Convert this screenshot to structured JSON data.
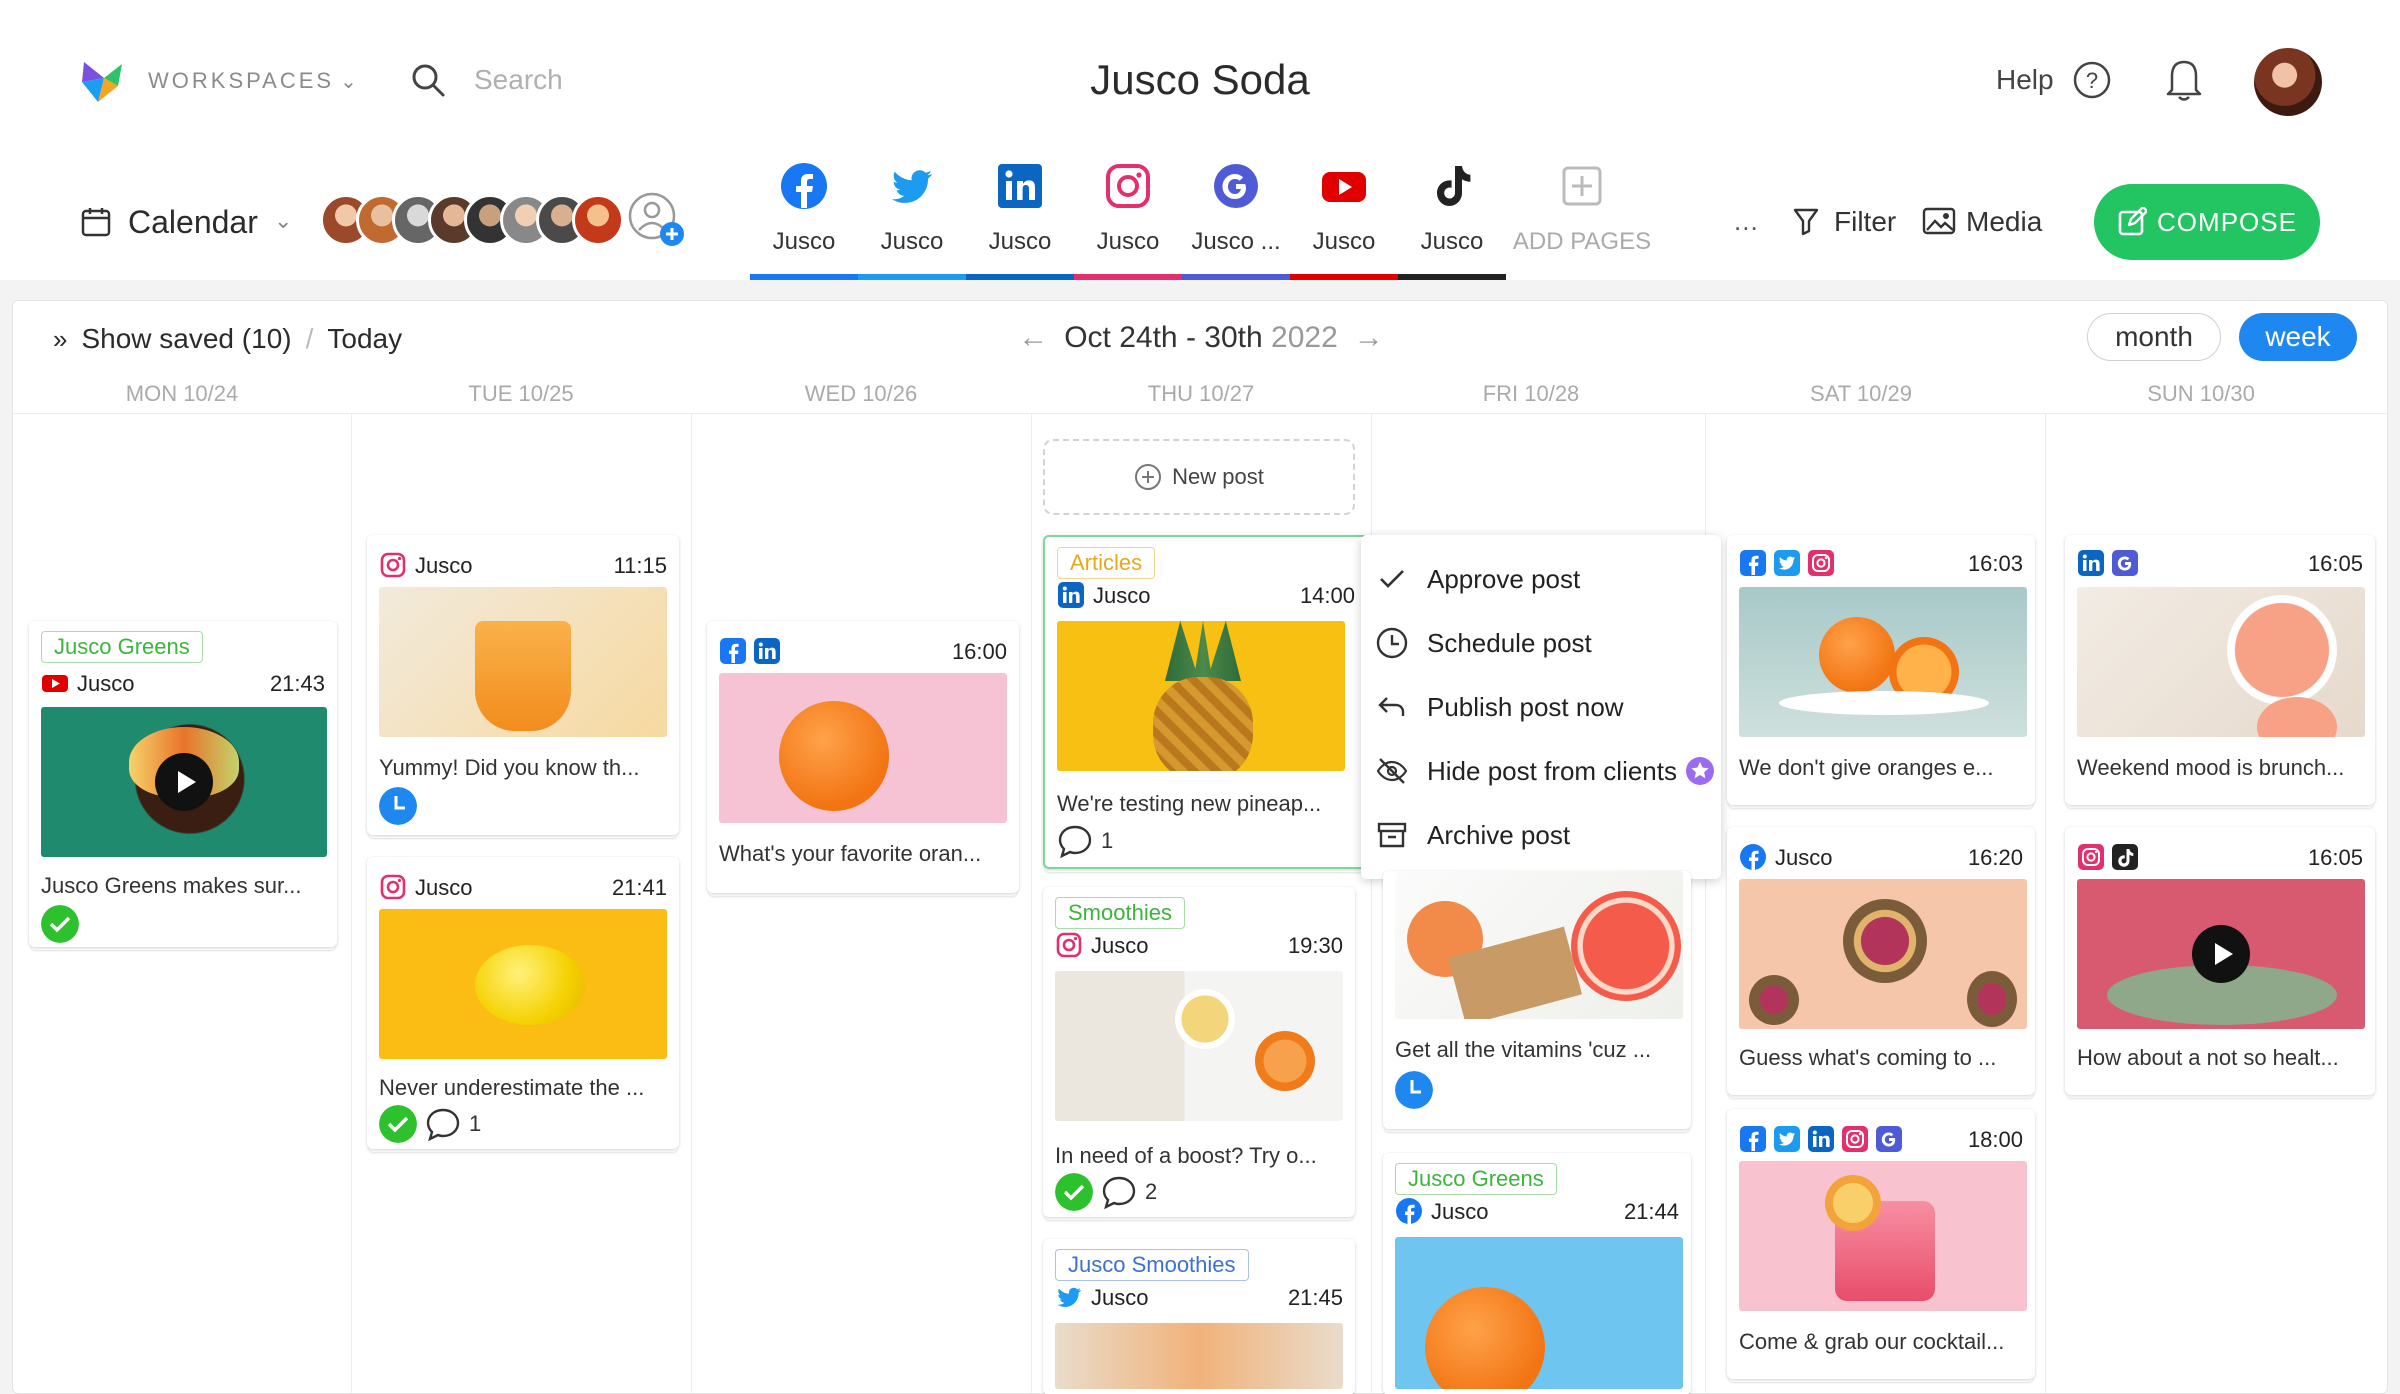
{
  "header": {
    "workspaces_label": "WORKSPACES",
    "search_placeholder": "Search",
    "title": "Jusco Soda",
    "help_label": "Help",
    "calendar_label": "Calendar",
    "compose_label": "COMPOSE",
    "filter_label": "Filter",
    "media_label": "Media",
    "more_label": "...",
    "add_pages_label": "ADD PAGES"
  },
  "pages": [
    {
      "network": "facebook",
      "label": "Jusco",
      "color": "#1877f2"
    },
    {
      "network": "twitter",
      "label": "Jusco",
      "color": "#1d9bf0"
    },
    {
      "network": "linkedin",
      "label": "Jusco",
      "color": "#0a66c2"
    },
    {
      "network": "instagram",
      "label": "Jusco",
      "color": "#e1306c"
    },
    {
      "network": "google",
      "label": "Jusco ...",
      "color": "#4f5bd5"
    },
    {
      "network": "youtube",
      "label": "Jusco",
      "color": "#e00000"
    },
    {
      "network": "tiktok",
      "label": "Jusco",
      "color": "#222222"
    }
  ],
  "toolbar": {
    "show_saved": "Show saved",
    "saved_count": "(10)",
    "sep": "/",
    "today": "Today",
    "range": "Oct 24th - 30th",
    "year": "2022",
    "month_label": "month",
    "week_label": "week"
  },
  "days": [
    "MON 10/24",
    "TUE 10/25",
    "WED 10/26",
    "THU 10/27",
    "FRI 10/28",
    "SAT 10/29",
    "SUN 10/30"
  ],
  "new_post_label": "New post",
  "menu": [
    "Approve post",
    "Schedule post",
    "Publish post now",
    "Hide post from clients",
    "Archive post"
  ],
  "posts": {
    "mon1": {
      "tag": "Jusco Greens",
      "account": "Jusco",
      "time": "21:43",
      "caption": "Jusco Greens makes sur...",
      "icons": [
        "youtube-icon"
      ]
    },
    "tue1": {
      "account": "Jusco",
      "time": "11:15",
      "caption": "Yummy! Did you know th...",
      "icons": [
        "instagram-icon"
      ]
    },
    "tue2": {
      "account": "Jusco",
      "time": "21:41",
      "caption": "Never underestimate the ...",
      "comments": "1",
      "icons": [
        "instagram-icon"
      ]
    },
    "wed1": {
      "time": "16:00",
      "caption": "What's your favorite oran...",
      "icons": [
        "facebook-icon",
        "linkedin-icon"
      ]
    },
    "thu1": {
      "tag": "Articles",
      "account": "Jusco",
      "time": "14:00",
      "caption": "We're testing new pineap...",
      "comments": "1",
      "icons": [
        "linkedin-icon"
      ]
    },
    "thu2": {
      "tag": "Smoothies",
      "account": "Jusco",
      "time": "19:30",
      "caption": "In need of a boost? Try o...",
      "comments": "2",
      "icons": [
        "instagram-icon"
      ]
    },
    "thu3": {
      "tag": "Jusco Smoothies",
      "account": "Jusco",
      "time": "21:45",
      "icons": [
        "twitter-icon"
      ]
    },
    "fri1": {
      "caption": "Get all the vitamins 'cuz ..."
    },
    "fri2": {
      "tag": "Jusco Greens",
      "account": "Jusco",
      "time": "21:44",
      "icons": [
        "facebook-icon"
      ]
    },
    "sat1": {
      "time": "16:03",
      "caption": "We don't give oranges e...",
      "icons": [
        "facebook-icon",
        "twitter-icon",
        "instagram-icon"
      ]
    },
    "sat2": {
      "account": "Jusco",
      "time": "16:20",
      "caption": "Guess what's coming to ...",
      "icons": [
        "facebook-icon"
      ]
    },
    "sat3": {
      "time": "18:00",
      "caption": "Come & grab our cocktail...",
      "icons": [
        "facebook-icon",
        "twitter-icon",
        "linkedin-icon",
        "instagram-icon",
        "google-icon"
      ]
    },
    "sun1": {
      "time": "16:05",
      "caption": "Weekend mood is brunch...",
      "icons": [
        "linkedin-icon",
        "google-icon"
      ]
    },
    "sun2": {
      "time": "16:05",
      "caption": "How about a not so healt...",
      "icons": [
        "instagram-icon",
        "tiktok-icon"
      ]
    }
  },
  "colors": {
    "accent": "#1e88f0",
    "compose": "#23c462",
    "approved": "#2ec12e",
    "scheduled": "#1e88f0"
  }
}
